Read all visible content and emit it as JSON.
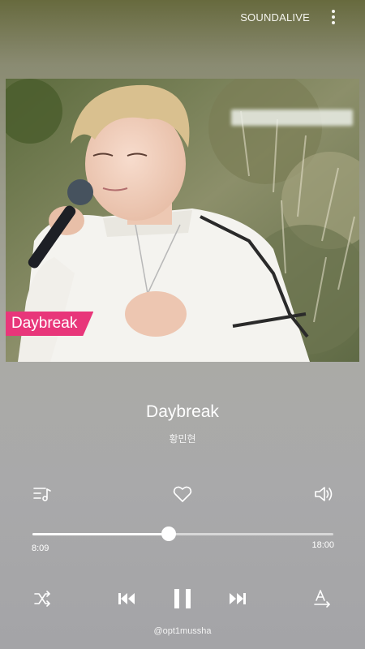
{
  "header": {
    "brand": "SOUNDALIVE",
    "menu_icon": "more-vertical-icon"
  },
  "video": {
    "song_badge": "Daybreak"
  },
  "track": {
    "title": "Daybreak",
    "artist": "황민현"
  },
  "actions": {
    "playlist_icon": "playlist-music-icon",
    "favorite_icon": "heart-outline-icon",
    "volume_icon": "volume-icon"
  },
  "progress": {
    "current": "8:09",
    "total": "18:00",
    "fraction": 0.453
  },
  "controls": {
    "shuffle_icon": "shuffle-icon",
    "previous_icon": "skip-previous-icon",
    "pause_icon": "pause-icon",
    "next_icon": "skip-next-icon",
    "lyrics_icon": "text-size-icon"
  },
  "watermark": "@opt1mussha",
  "colors": {
    "badge": "#e8367a",
    "foreground": "#ffffff"
  }
}
